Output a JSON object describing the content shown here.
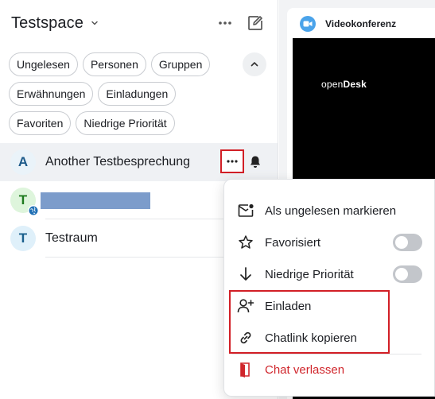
{
  "sidebar": {
    "title": "Testspace",
    "filters": [
      [
        "Ungelesen",
        "Personen",
        "Gruppen"
      ],
      [
        "Erwähnungen",
        "Einladungen"
      ],
      [
        "Favoriten",
        "Niedrige Priorität"
      ]
    ],
    "rooms": [
      {
        "initial": "A",
        "name": "Another Testbesprechung",
        "active": true
      },
      {
        "initial": "T",
        "name": "",
        "redacted": true
      },
      {
        "initial": "T",
        "name": "Testraum"
      }
    ]
  },
  "conference": {
    "title": "Videokonferenz",
    "brand_prefix": "open",
    "brand_suffix": "Desk"
  },
  "context_menu": {
    "items": [
      {
        "label": "Als ungelesen markieren",
        "icon": "mark-unread-icon"
      },
      {
        "label": "Favorisiert",
        "icon": "star-icon",
        "toggle": false
      },
      {
        "label": "Niedrige Priorität",
        "icon": "arrow-down-icon",
        "toggle": false
      },
      {
        "label": "Einladen",
        "icon": "add-person-icon"
      },
      {
        "label": "Chatlink kopieren",
        "icon": "link-icon"
      },
      {
        "label": "Chat verlassen",
        "icon": "leave-icon",
        "danger": true
      }
    ]
  },
  "colors": {
    "accent_red": "#d21f26",
    "danger_text": "#d0262c",
    "redaction": "#7c9ccb",
    "video_bg": "#000000"
  }
}
